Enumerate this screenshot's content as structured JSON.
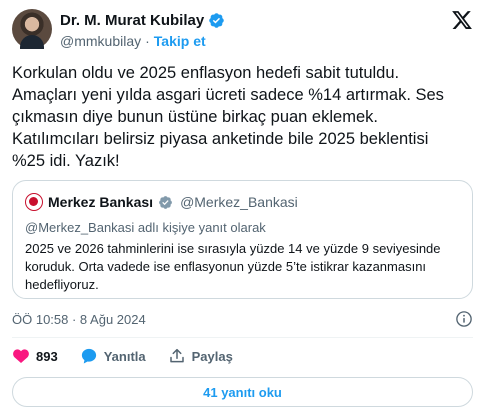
{
  "author": {
    "name": "Dr. M. Murat Kubilay",
    "handle": "@mmkubilay",
    "separator": "·",
    "follow_label": "Takip et"
  },
  "tweet": {
    "lines": [
      "Korkulan oldu ve 2025 enflasyon hedefi sabit tutuldu.",
      "Amaçları yeni yılda asgari ücreti sadece %14 artırmak. Ses",
      "çıkmasın diye bunun üstüne birkaç puan eklemek.",
      "Katılımcıları belirsiz piyasa anketinde bile 2025 beklentisi",
      "%25 idi. Yazık!"
    ]
  },
  "quote": {
    "name": "Merkez Bankası",
    "handle": "@Merkez_Bankasi",
    "reply_to": "@Merkez_Bankasi adlı kişiye yanıt olarak",
    "body_lines": [
      "2025 ve 2026 tahminlerini ise sırasıyla yüzde 14 ve yüzde 9 seviyesinde",
      "koruduk. Orta vadede ise enflasyonun yüzde 5’te istikrar kazanmasını",
      "hedefliyoruz."
    ]
  },
  "timestamp": "ÖÖ 10:58 · 8 Ağu 2024",
  "actions": {
    "like_count": "893",
    "reply_label": "Yanıtla",
    "share_label": "Paylaş"
  },
  "replies_button": "41 yanıtı oku",
  "colors": {
    "accent": "#1d9bf0",
    "like": "#f91880",
    "secondary_text": "#536471",
    "gov_badge": "#829aab"
  },
  "icons": [
    "verified-badge-icon",
    "x-logo-icon",
    "gov-badge-icon",
    "info-icon",
    "heart-icon",
    "reply-icon",
    "share-icon"
  ]
}
